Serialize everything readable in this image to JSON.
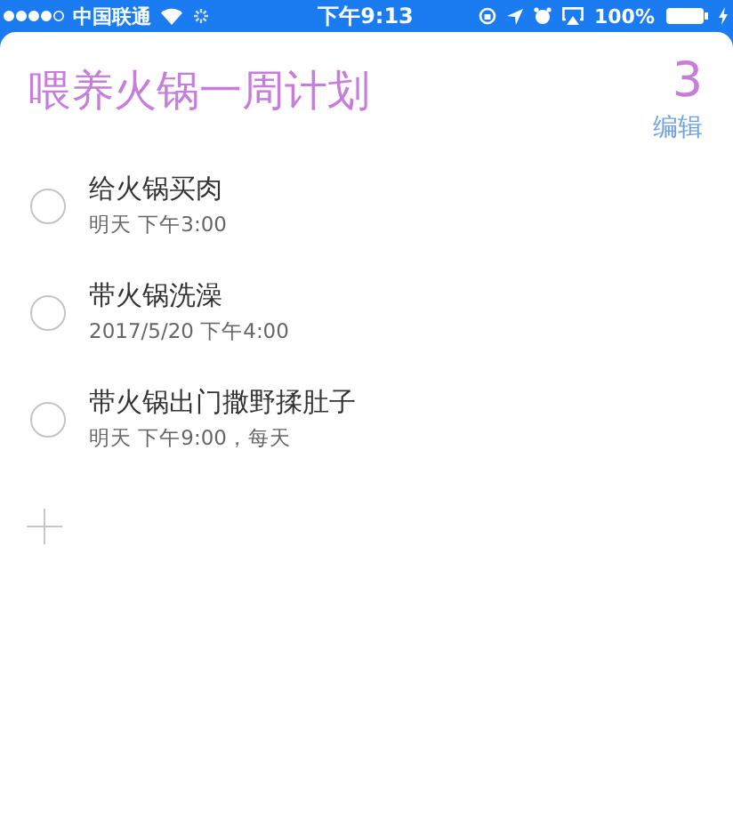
{
  "status_bar": {
    "carrier": "中国联通",
    "time": "下午9:13",
    "battery": "100%"
  },
  "list": {
    "title": "喂养火锅一周计划",
    "count": "3",
    "edit": "编辑"
  },
  "reminders": [
    {
      "title": "给火锅买肉",
      "due": "明天 下午3:00",
      "completed": false
    },
    {
      "title": "带火锅洗澡",
      "due": "2017/5/20 下午4:00",
      "completed": false
    },
    {
      "title": "带火锅出门撒野揉肚子",
      "due": "明天 下午9:00，每天",
      "completed": false
    }
  ]
}
